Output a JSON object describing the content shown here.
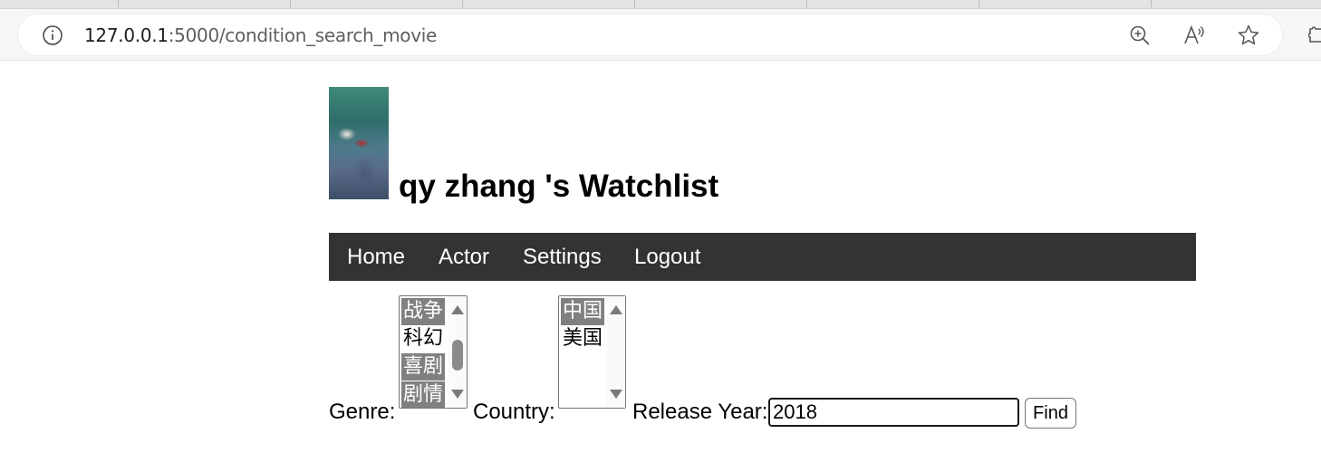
{
  "browser": {
    "url_host": "127.0.0.1",
    "url_rest": ":5000/condition_search_movie",
    "icons": [
      "info-icon",
      "zoom-in-icon",
      "read-aloud-icon",
      "favorite-star-icon",
      "extensions-icon"
    ]
  },
  "header": {
    "title": "qy zhang 's Watchlist",
    "avatar_icon": "poster-image"
  },
  "nav": {
    "items": [
      {
        "label": "Home"
      },
      {
        "label": "Actor"
      },
      {
        "label": "Settings"
      },
      {
        "label": "Logout"
      }
    ],
    "background": "#333333"
  },
  "search": {
    "genre_label": "Genre:",
    "genre_options": [
      {
        "label": "战争",
        "selected": true
      },
      {
        "label": "科幻",
        "selected": false
      },
      {
        "label": "喜剧",
        "selected": true
      },
      {
        "label": "剧情",
        "selected": true
      }
    ],
    "country_label": "Country:",
    "country_options": [
      {
        "label": "中国",
        "selected": true
      },
      {
        "label": "美国",
        "selected": false
      }
    ],
    "year_label": "Release Year:",
    "year_value": "2018",
    "find_label": "Find",
    "selected_color": "#808080"
  }
}
